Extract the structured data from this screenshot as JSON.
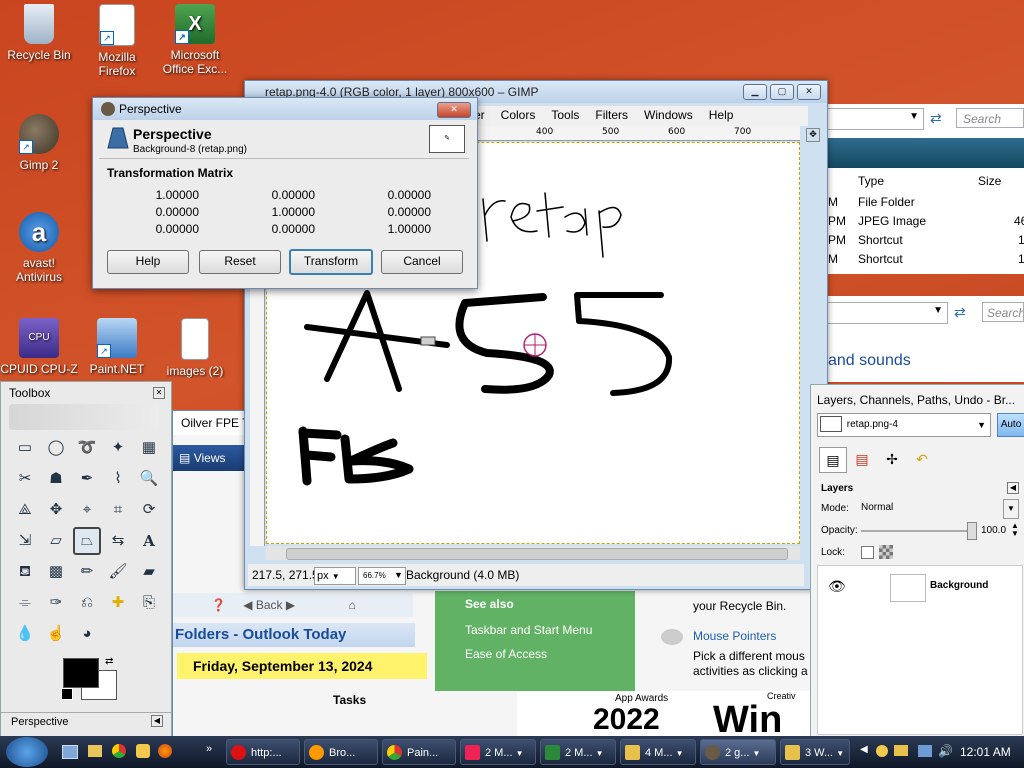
{
  "desktop_icons": [
    {
      "label_line1": "Recycle Bin",
      "label_line2": ""
    },
    {
      "label_line1": "Mozilla",
      "label_line2": "Firefox"
    },
    {
      "label_line1": "Microsoft",
      "label_line2": "Office Exc..."
    },
    {
      "label_line1": "Gimp 2",
      "label_line2": ""
    },
    {
      "label_line1": "avast!",
      "label_line2": "Antivirus"
    },
    {
      "label_line1": "CPUID CPU-Z",
      "label_line2": ""
    },
    {
      "label_line1": "Paint.NET",
      "label_line2": ""
    },
    {
      "label_line1": "images (2)",
      "label_line2": ""
    }
  ],
  "gimp": {
    "title": "retap.png-4.0 (RGB color, 1 layer) 800x600 – GIMP",
    "menu": [
      "er",
      "Colors",
      "Tools",
      "Filters",
      "Windows",
      "Help"
    ],
    "ruler_h": [
      "400",
      "500",
      "600",
      "700"
    ],
    "status": {
      "coords": "217.5, 271.5",
      "unit": "px",
      "zoom": "66.7%",
      "info": "Background (4.0 MB)"
    }
  },
  "dialog": {
    "title": "Perspective",
    "heading": "Perspective",
    "subheading": "Background-8 (retap.png)",
    "matrix_label": "Transformation Matrix",
    "matrix": [
      [
        "1.00000",
        "0.00000",
        "0.00000"
      ],
      [
        "0.00000",
        "1.00000",
        "0.00000"
      ],
      [
        "0.00000",
        "0.00000",
        "1.00000"
      ]
    ],
    "buttons": {
      "help": "Help",
      "reset": "Reset",
      "transform": "Transform",
      "cancel": "Cancel"
    }
  },
  "toolbox": {
    "title": "Toolbox",
    "tool_options": "Perspective"
  },
  "explorer": {
    "search_placeholder": "Search",
    "search_placeholder_2": "Search",
    "columns": {
      "type": "Type",
      "size": "Size"
    },
    "rows": [
      {
        "date": "M",
        "type": "File Folder",
        "size": ""
      },
      {
        "date": "PM",
        "type": "JPEG Image",
        "size": "46"
      },
      {
        "date": "PM",
        "type": "Shortcut",
        "size": "1"
      },
      {
        "date": "M",
        "type": "Shortcut",
        "size": "1"
      }
    ],
    "sounds": "and sounds"
  },
  "layers": {
    "title": "Layers, Channels, Paths, Undo - Br...",
    "image": "retap.png-4",
    "auto": "Auto",
    "section": "Layers",
    "mode_label": "Mode:",
    "mode_value": "Normal",
    "opacity_label": "Opacity:",
    "opacity_value": "100.0",
    "lock_label": "Lock:",
    "layer_name": "Background"
  },
  "outlook": {
    "tab": "Oilver FPE T",
    "views": "Views",
    "back": "Back",
    "heading": "Folders - Outlook Today",
    "date": "Friday, September 13, 2024",
    "tasks": "Tasks"
  },
  "control_panel": {
    "see_also": "See also",
    "links": [
      "Taskbar and Start Menu",
      "Ease of Access"
    ],
    "recycle_text": "your Recycle Bin.",
    "mouse_pointers": "Mouse Pointers",
    "mouse_desc_1": "Pick a different mous",
    "mouse_desc_2": "activities as clicking a"
  },
  "ad": {
    "awards": "App Awards",
    "year": "2022",
    "win": "Win",
    "creative": "Creativ"
  },
  "canvas_text": "retap",
  "taskbar": {
    "items": [
      "http:...",
      "Bro...",
      "Pain...",
      "2 M...",
      "2 M...",
      "4 M...",
      "2 g...",
      "3 W..."
    ],
    "clock": "12:01 AM"
  },
  "colors": {
    "accent": "#3c7fb1",
    "outlook_date_bg": "#fff36b",
    "green_panel": "#62b266"
  }
}
